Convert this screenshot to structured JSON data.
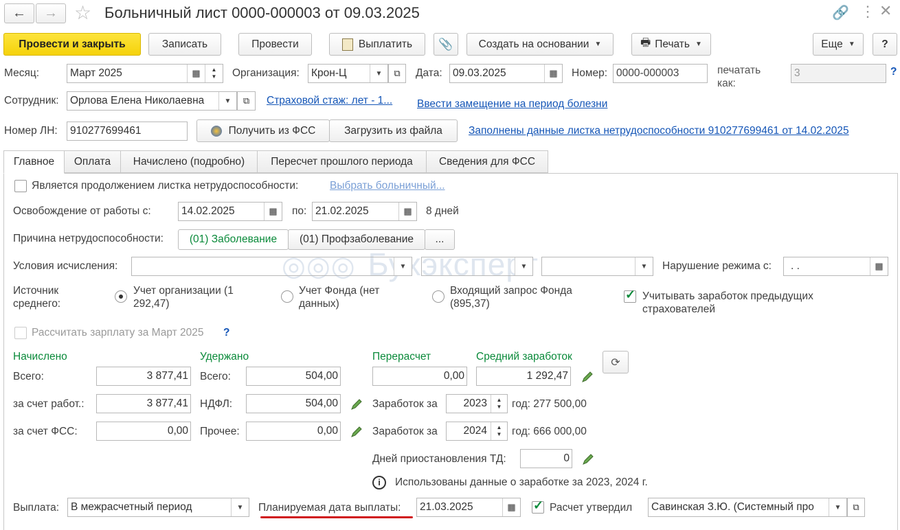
{
  "window": {
    "title": "Больничный лист 0000-000003 от 09.03.2025"
  },
  "toolbar": {
    "post_close": "Провести и закрыть",
    "save": "Записать",
    "post": "Провести",
    "pay": "Выплатить",
    "create_based": "Создать на основании",
    "print": "Печать",
    "more": "Еще",
    "help": "?"
  },
  "header": {
    "month_label": "Месяц:",
    "month_value": "Март 2025",
    "org_label": "Организация:",
    "org_value": "Крон-Ц",
    "date_label": "Дата:",
    "date_value": "09.03.2025",
    "number_label": "Номер:",
    "number_value": "0000-000003",
    "print_as_label": "печатать как:",
    "print_as_value": "3",
    "employee_label": "Сотрудник:",
    "employee_value": "Орлова Елена Николаевна",
    "insurance_link": "Страховой стаж: лет - 1...",
    "replacement_link": "Ввести замещение на период болезни",
    "ln_label": "Номер ЛН:",
    "ln_value": "910277699461",
    "get_fss": "Получить из ФСС",
    "load_file": "Загрузить из файла",
    "filled_link": "Заполнены данные листка нетрудоспособности 910277699461 от 14.02.2025"
  },
  "tabs": [
    "Главное",
    "Оплата",
    "Начислено (подробно)",
    "Пересчет прошлого периода",
    "Сведения для ФСС"
  ],
  "main": {
    "continuation_label": "Является продолжением листка нетрудоспособности:",
    "choose_link": "Выбрать больничный...",
    "release_label": "Освобождение от работы с:",
    "release_from": "14.02.2025",
    "to_label": "по:",
    "release_to": "21.02.2025",
    "days": "8 дней",
    "reason_label": "Причина нетрудоспособности:",
    "reason_1": "(01) Заболевание",
    "reason_2": "(01) Профзаболевание",
    "reason_more": "...",
    "conditions_label": "Условия исчисления:",
    "violation_label": "Нарушение режима с:",
    "violation_value": " .  .",
    "source_label": "Источник среднего:",
    "src_org": "Учет организации (1 292,47)",
    "src_fund": "Учет Фонда (нет данных)",
    "src_request": "Входящий запрос Фонда (895,37)",
    "prev_insurers": "Учитывать заработок предыдущих страхователей",
    "calc_salary": "Рассчитать зарплату за Март 2025",
    "accrued_header": "Начислено",
    "withheld_header": "Удержано",
    "recalc_header": "Перерасчет",
    "avg_header": "Средний заработок",
    "total_label": "Всего:",
    "accrued_total": "3 877,41",
    "withheld_total_label": "Всего:",
    "withheld_total": "504,00",
    "recalc_value": "0,00",
    "avg_value": "1 292,47",
    "employer_label": "за счет работ.:",
    "accrued_employer": "3 877,41",
    "ndfl_label": "НДФЛ:",
    "ndfl_value": "504,00",
    "earn_label_1": "Заработок за",
    "year_1": "2023",
    "year_1_sum": "год: 277 500,00",
    "fss_label": "за счет ФСС:",
    "accrued_fss": "0,00",
    "other_label": "Прочее:",
    "other_value": "0,00",
    "earn_label_2": "Заработок за",
    "year_2": "2024",
    "year_2_sum": "год: 666 000,00",
    "suspension_label": "Дней приостановления ТД:",
    "suspension_value": "0",
    "info_text": "Использованы данные о заработке за  2023,  2024 г.",
    "payout_label": "Выплата:",
    "payout_value": "В межрасчетный период",
    "planned_date_label": "Планируемая дата выплаты:",
    "planned_date": "21.03.2025",
    "approved_label": "Расчет утвердил",
    "approved_value": "Савинская З.Ю. (Системный про"
  },
  "watermark": "Бухэксперт",
  "colors": {
    "accent_yellow": "#f5d20a",
    "green": "#0a8a3a",
    "link": "#1556b7",
    "underline_red": "#d0161b"
  }
}
